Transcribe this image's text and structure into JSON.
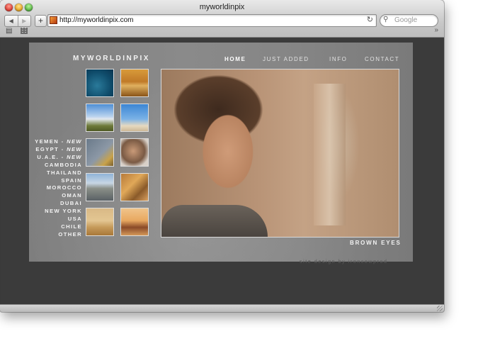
{
  "window": {
    "title": "myworldinpix"
  },
  "toolbar": {
    "back_icon": "◀",
    "forward_icon": "▶",
    "add_icon": "+",
    "url": "http://myworldinpix.com",
    "reload_icon": "↻",
    "search_placeholder": "Google",
    "bookmarks_icon": "📖",
    "more_icon": "»"
  },
  "site": {
    "brand": "MYWORLDINPIX",
    "nav": [
      "HOME",
      "JUST ADDED",
      "INFO",
      "CONTACT"
    ],
    "active_nav": "HOME",
    "countries": [
      {
        "name": "YEMEN - ",
        "tag": "NEW"
      },
      {
        "name": "EGYPT - ",
        "tag": "NEW"
      },
      {
        "name": "U.A.E. - ",
        "tag": "NEW"
      },
      {
        "name": "CAMBODIA",
        "tag": ""
      },
      {
        "name": "THAILAND",
        "tag": ""
      },
      {
        "name": "SPAIN",
        "tag": ""
      },
      {
        "name": "MOROCCO",
        "tag": ""
      },
      {
        "name": "OMAN",
        "tag": ""
      },
      {
        "name": "DUBAI",
        "tag": ""
      },
      {
        "name": "NEW YORK",
        "tag": ""
      },
      {
        "name": "USA",
        "tag": ""
      },
      {
        "name": "CHILE",
        "tag": ""
      },
      {
        "name": "OTHER",
        "tag": ""
      }
    ],
    "photo_caption": "BROWN EYES",
    "credit": "site design by ironcowprod"
  },
  "colors": {
    "page_background": "#3b3b3b",
    "panel": "#808080"
  }
}
